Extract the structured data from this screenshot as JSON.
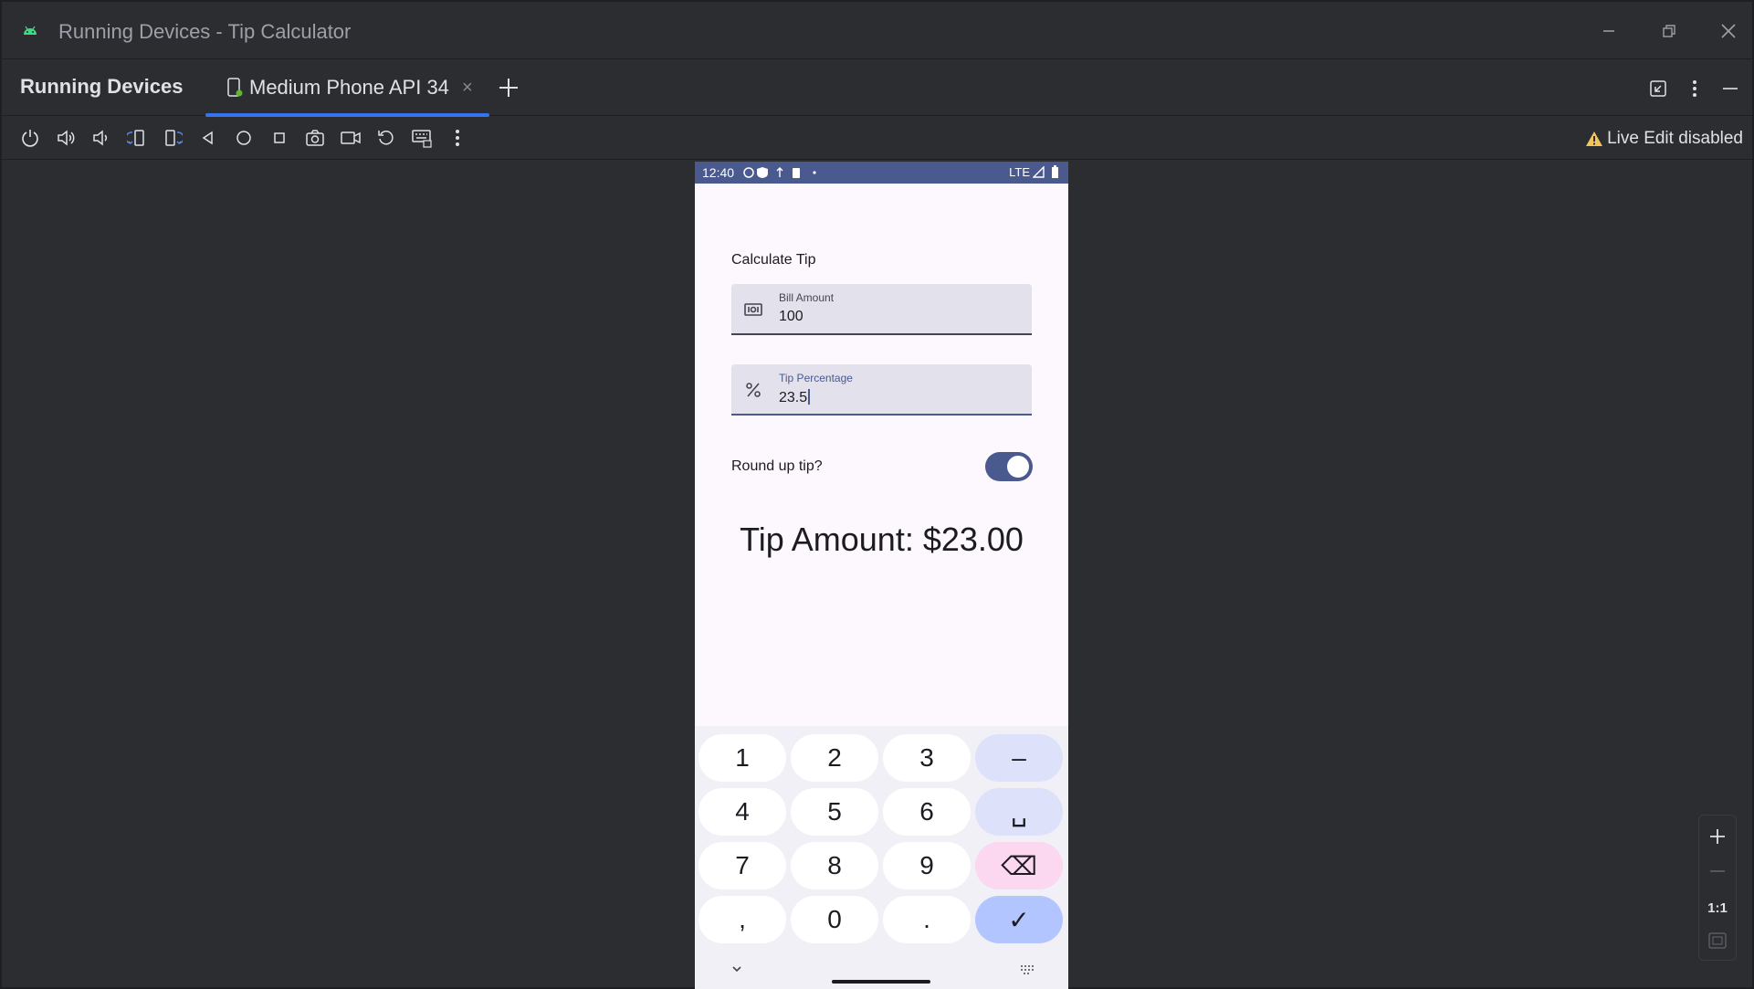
{
  "window": {
    "title": "Running Devices - Tip Calculator",
    "icons": {
      "app": "android-icon",
      "minimize": "minimize-icon",
      "restore": "restore-icon",
      "close": "close-icon"
    }
  },
  "panel": {
    "title": "Running Devices",
    "tab_label": "Medium Phone API 34",
    "tab_close": "×"
  },
  "toolbar": {
    "icons": [
      "power-icon",
      "volume-up-icon",
      "volume-down-icon",
      "rotate-left-icon",
      "rotate-right-icon",
      "back-icon",
      "home-icon",
      "overview-icon",
      "screenshot-icon",
      "screen-record-icon",
      "reset-icon",
      "keyboard-icon",
      "more-icon"
    ],
    "live_edit": "Live Edit disabled"
  },
  "device": {
    "status": {
      "time": "12:40",
      "network": "LTE"
    },
    "app": {
      "heading": "Calculate Tip",
      "bill_field": {
        "label": "Bill Amount",
        "value": "100"
      },
      "tip_field": {
        "label": "Tip Percentage",
        "value": "23.5"
      },
      "round_up_label": "Round up tip?",
      "round_up_on": true,
      "tip_amount": "Tip Amount: $23.00"
    },
    "keyboard": {
      "rows": [
        [
          "1",
          "2",
          "3",
          "–"
        ],
        [
          "4",
          "5",
          "6",
          "␣"
        ],
        [
          "7",
          "8",
          "9",
          "⌫"
        ],
        [
          ",",
          "0",
          ".",
          "✓"
        ]
      ]
    }
  },
  "zoom": {
    "actual_size": "1:1"
  },
  "colors": {
    "accent": "#3574f0",
    "phone_primary": "#4a5a8f",
    "warning": "#f2c55c"
  }
}
